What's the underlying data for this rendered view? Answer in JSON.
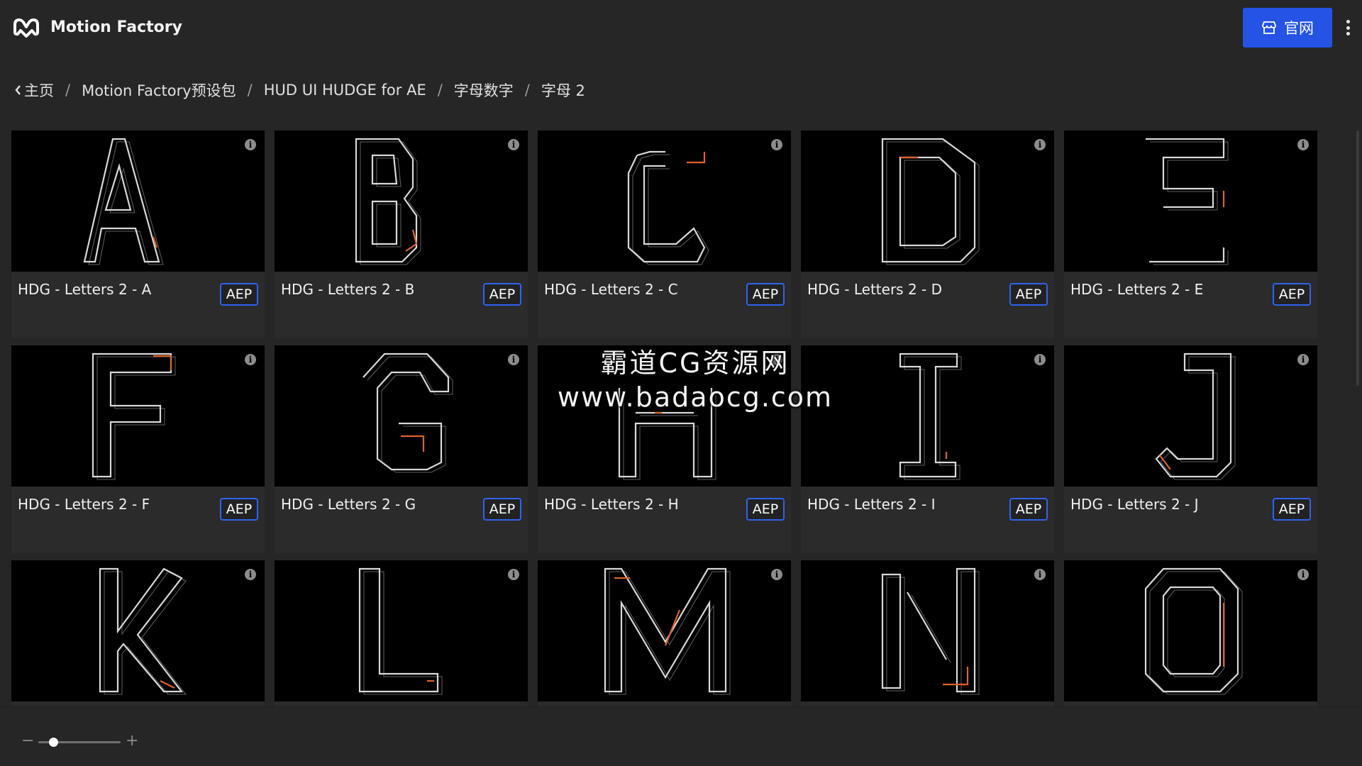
{
  "header": {
    "app_title": "Motion Factory",
    "site_button_label": "官网",
    "site_button_icon": "store-icon",
    "more_icon": "more-vertical-icon",
    "accent_color": "#2453e6"
  },
  "breadcrumb": {
    "items": [
      "主页",
      "Motion Factory预设包",
      "HUD UI HUDGE for AE",
      "字母数字",
      "字母 2"
    ],
    "separator": "/"
  },
  "cards": [
    {
      "letter": "A",
      "title": "HDG - Letters 2 - A",
      "badge": "AEP"
    },
    {
      "letter": "B",
      "title": "HDG - Letters 2 - B",
      "badge": "AEP"
    },
    {
      "letter": "C",
      "title": "HDG - Letters 2 - C",
      "badge": "AEP"
    },
    {
      "letter": "D",
      "title": "HDG - Letters 2 - D",
      "badge": "AEP"
    },
    {
      "letter": "E",
      "title": "HDG - Letters 2 - E",
      "badge": "AEP"
    },
    {
      "letter": "F",
      "title": "HDG - Letters 2 - F",
      "badge": "AEP"
    },
    {
      "letter": "G",
      "title": "HDG - Letters 2 - G",
      "badge": "AEP"
    },
    {
      "letter": "H",
      "title": "HDG - Letters 2 - H",
      "badge": "AEP"
    },
    {
      "letter": "I",
      "title": "HDG - Letters 2 - I",
      "badge": "AEP"
    },
    {
      "letter": "J",
      "title": "HDG - Letters 2 - J",
      "badge": "AEP"
    },
    {
      "letter": "K",
      "title": "",
      "badge": ""
    },
    {
      "letter": "L",
      "title": "",
      "badge": ""
    },
    {
      "letter": "M",
      "title": "",
      "badge": ""
    },
    {
      "letter": "N",
      "title": "",
      "badge": ""
    },
    {
      "letter": "O",
      "title": "",
      "badge": ""
    }
  ],
  "watermark": {
    "line1": "霸道CG资源网",
    "line2": "www.badaocg.com"
  },
  "zoom": {
    "minus": "−",
    "plus": "+",
    "level": 0.18
  },
  "colors": {
    "line": "#d8d8d8",
    "accent_line": "#e0622a"
  }
}
